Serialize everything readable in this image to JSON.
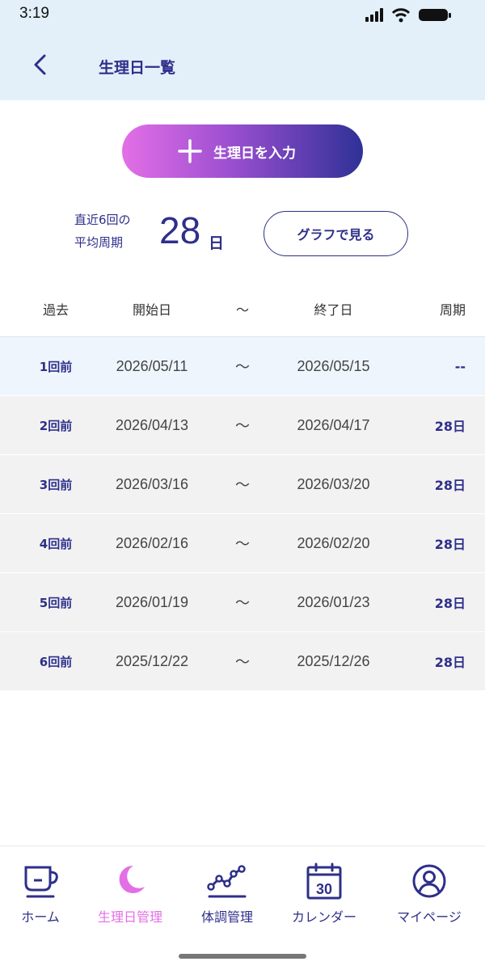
{
  "status_bar": {
    "time": "3:19"
  },
  "header": {
    "title": "生理日一覧"
  },
  "add_button": {
    "label": "生理日を入力"
  },
  "average": {
    "label_line1": "直近6回の",
    "label_line2": "平均周期",
    "value": "28",
    "unit": "日"
  },
  "graph_button": {
    "label": "グラフで見る"
  },
  "table": {
    "columns": {
      "past": "過去",
      "start": "開始日",
      "tilde": "〜",
      "end": "終了日",
      "cycle": "周期"
    },
    "rows": [
      {
        "past": "1回前",
        "start": "2026/05/11",
        "tilde": "〜",
        "end": "2026/05/15",
        "cycle": "--"
      },
      {
        "past": "2回前",
        "start": "2026/04/13",
        "tilde": "〜",
        "end": "2026/04/17",
        "cycle": "28日"
      },
      {
        "past": "3回前",
        "start": "2026/03/16",
        "tilde": "〜",
        "end": "2026/03/20",
        "cycle": "28日"
      },
      {
        "past": "4回前",
        "start": "2026/02/16",
        "tilde": "〜",
        "end": "2026/02/20",
        "cycle": "28日"
      },
      {
        "past": "5回前",
        "start": "2026/01/19",
        "tilde": "〜",
        "end": "2026/01/23",
        "cycle": "28日"
      },
      {
        "past": "6回前",
        "start": "2025/12/22",
        "tilde": "〜",
        "end": "2025/12/26",
        "cycle": "28日"
      }
    ]
  },
  "tab_bar": {
    "tabs": [
      {
        "label": "ホーム",
        "icon": "cup-icon"
      },
      {
        "label": "生理日管理",
        "icon": "moon-icon",
        "active": true
      },
      {
        "label": "体調管理",
        "icon": "line-graph-icon"
      },
      {
        "label": "カレンダー",
        "icon": "calendar-icon",
        "calendar_day": "30"
      },
      {
        "label": "マイページ",
        "icon": "person-icon"
      }
    ]
  },
  "colors": {
    "primary": "#2e2f8a",
    "accent_pink": "#e36fe6",
    "header_bg": "#e3f0fa",
    "row_bg": "#f2f2f2",
    "current_row_bg": "#eef5fd"
  }
}
